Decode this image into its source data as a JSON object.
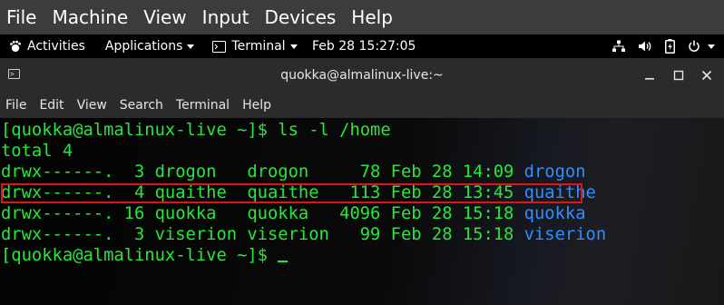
{
  "vm_menu": {
    "items": [
      "File",
      "Machine",
      "View",
      "Input",
      "Devices",
      "Help"
    ]
  },
  "gnome_bar": {
    "activities": "Activities",
    "applications": "Applications",
    "terminal": "Terminal",
    "clock": "Feb 28  15:27:05",
    "tray_icons": [
      "network-icon",
      "volume-icon",
      "battery-icon",
      "power-icon"
    ]
  },
  "window": {
    "title": "quokka@almalinux-live:~",
    "controls": [
      "minimize",
      "maximize",
      "close"
    ]
  },
  "term_menu": {
    "items": [
      "File",
      "Edit",
      "View",
      "Search",
      "Terminal",
      "Help"
    ]
  },
  "terminal": {
    "prompt1": "[quokka@almalinux-live ~]$ ls -l /home",
    "total": "total 4",
    "rows": [
      {
        "text": "drwx------.  3 drogon   drogon     78 Feb 28 14:09 ",
        "name": "drogon"
      },
      {
        "text": "drwx------.  4 quaithe  quaithe   113 Feb 28 13:45 ",
        "name": "quaithe"
      },
      {
        "text": "drwx------. 16 quokka   quokka   4096 Feb 28 15:18 ",
        "name": "quokka"
      },
      {
        "text": "drwx------.  3 viserion viserion   99 Feb 28 15:18 ",
        "name": "viserion"
      }
    ],
    "prompt2": "[quokka@almalinux-live ~]$ "
  },
  "colors": {
    "terminal_text": "#26e73a",
    "directory": "#2f8fff",
    "highlight_border": "#e01616"
  }
}
